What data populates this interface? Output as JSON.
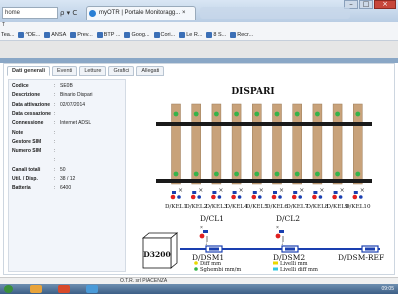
{
  "browser": {
    "address_text": "home",
    "address_icons": "ρ ▾ C",
    "tab_title": "myOTR | Portale Monitoragg...",
    "tab_close": "×",
    "menu_char": "T",
    "favorites": [
      "Tea...",
      "^DE...",
      "ANSA",
      "Prev...",
      "BTP ...",
      "Goog...",
      "Cori...",
      "Le R...",
      "8 S...",
      "Recr..."
    ]
  },
  "panel_tabs": [
    "Dati generali",
    "Eventi",
    "Letture",
    "Grafici",
    "Allegati"
  ],
  "info": {
    "rows": [
      {
        "label": "Codice",
        "value": "SE0B"
      },
      {
        "label": "Descrizione",
        "value": "Binario Dispari"
      },
      {
        "label": "Data attivazione",
        "value": "02/07/2014"
      },
      {
        "label": "Data cessazione",
        "value": ""
      },
      {
        "label": "Connessione",
        "value": "Internet ADSL"
      },
      {
        "label": "Note",
        "value": ""
      },
      {
        "label": "Gestore SIM",
        "value": ""
      },
      {
        "label": "Numero SIM",
        "value": ""
      },
      {
        "label": "",
        "value": ""
      },
      {
        "label": "Canali totali",
        "value": "50"
      },
      {
        "label": "Util. / Disp.",
        "value": "38 / 12"
      },
      {
        "label": "Batteria",
        "value": "6400"
      }
    ]
  },
  "diagram": {
    "title": "DISPARI",
    "kel_labels": [
      "D/KEL1",
      "D/KEL2",
      "D/KEL3",
      "D/KEL4",
      "D/KEL5",
      "D/KEL6",
      "D/KEL7",
      "D/KEL8",
      "D/KEL9",
      "D/KEL10"
    ],
    "cl1": "D/CL1",
    "cl2": "D/CL2",
    "box": "D3200",
    "dsm1": "D/DSM1",
    "dsm2": "D/DSM2",
    "dsm_ref": "D/DSM-REF",
    "legend": {
      "diff": "Diff mm",
      "sghembi": "Sghembi mm/m",
      "livelli_mm": "Livelli mm",
      "livelli_diff": "Livelli diff mm"
    },
    "colors": {
      "sleeper": "#c8a27a",
      "rail": "#1a1a1a",
      "sensor_green": "#35b34a",
      "sensor_red": "#e02020",
      "sensor_blue": "#1a3fb0",
      "legend_yellow": "#e8d800",
      "legend_cyan": "#30c8e0"
    }
  },
  "status": {
    "text": "O.T.R. srl PIACENZA"
  },
  "taskbar": {
    "clock": "09:05"
  }
}
